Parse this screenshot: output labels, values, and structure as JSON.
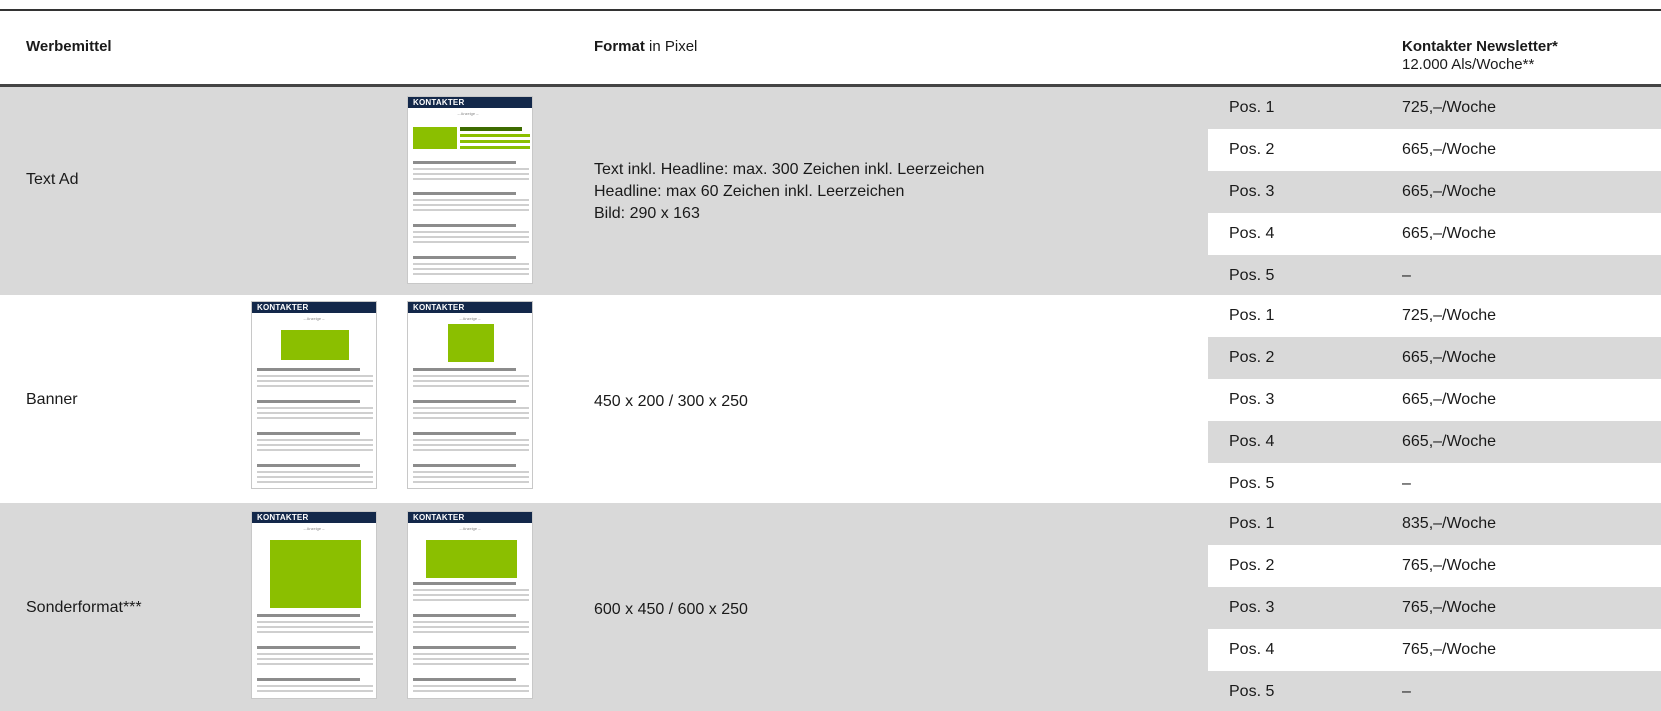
{
  "header": {
    "col1": "Werbemittel",
    "col2_bold": "Format",
    "col2_rest": " in Pixel",
    "col3_title": "Kontakter Newsletter*",
    "col3_sub": "12.000  Als/Woche**"
  },
  "thumb_brand": "KONTAKTER",
  "thumb_anzeige": "– Anzeige –",
  "sections": [
    {
      "label": "Text Ad",
      "format_lines": [
        "Text inkl. Headline: max. 300 Zeichen inkl. Leerzeichen",
        "Headline: max 60 Zeichen inkl. Leerzeichen",
        "Bild: 290 x 163"
      ],
      "rows": [
        {
          "pos": "Pos. 1",
          "price": "725,–/Woche"
        },
        {
          "pos": "Pos. 2",
          "price": "665,–/Woche"
        },
        {
          "pos": "Pos. 3",
          "price": "665,–/Woche"
        },
        {
          "pos": "Pos. 4",
          "price": "665,–/Woche"
        },
        {
          "pos": "Pos. 5",
          "price": "–"
        }
      ]
    },
    {
      "label": "Banner",
      "format_lines": [
        "450 x 200 / 300 x 250"
      ],
      "rows": [
        {
          "pos": "Pos. 1",
          "price": "725,–/Woche"
        },
        {
          "pos": "Pos. 2",
          "price": "665,–/Woche"
        },
        {
          "pos": "Pos. 3",
          "price": "665,–/Woche"
        },
        {
          "pos": "Pos. 4",
          "price": "665,–/Woche"
        },
        {
          "pos": "Pos. 5",
          "price": "–"
        }
      ]
    },
    {
      "label": "Sonderformat***",
      "format_lines": [
        "600 x 450 / 600 x 250"
      ],
      "rows": [
        {
          "pos": "Pos. 1",
          "price": "835,–/Woche"
        },
        {
          "pos": "Pos. 2",
          "price": "765,–/Woche"
        },
        {
          "pos": "Pos. 3",
          "price": "765,–/Woche"
        },
        {
          "pos": "Pos. 4",
          "price": "765,–/Woche"
        },
        {
          "pos": "Pos. 5",
          "price": "–"
        }
      ]
    }
  ]
}
